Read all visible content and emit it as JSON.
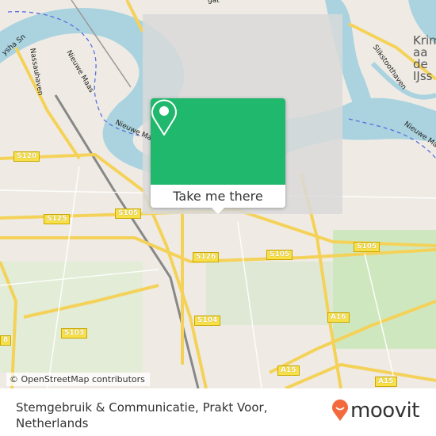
{
  "map": {
    "attribution": "© OpenStreetMap contributors",
    "labels": {
      "river_1": "Nieuwe Maas",
      "river_2": "Nieuwe Maas",
      "river_3": "Nieuwe Maas",
      "harbour_1": "Nassauhaven",
      "harbour_2": "Slikstoothaven",
      "place_krimpen": "Krim\naa\nde\nIJss",
      "top_partial": "gat",
      "left_partial": "ysha Sn"
    },
    "road_shields": [
      "S120",
      "S125",
      "S105",
      "S126",
      "S105",
      "S105",
      "S104",
      "S103",
      "A16",
      "A15",
      "A15",
      "8"
    ],
    "colors": {
      "water": "#aad3df",
      "land": "#efebe4",
      "major_road": "#f7e04a",
      "green": "#c8e6b0",
      "popup": "#1fb86c"
    }
  },
  "popup": {
    "icon": "map-pin-icon",
    "button_label": "Take me there"
  },
  "footer": {
    "place_name": "Stemgebruik & Communicatie, Prakt Voor, Netherlands",
    "logo_text": "moovit",
    "logo_color": "#f26a3d"
  }
}
